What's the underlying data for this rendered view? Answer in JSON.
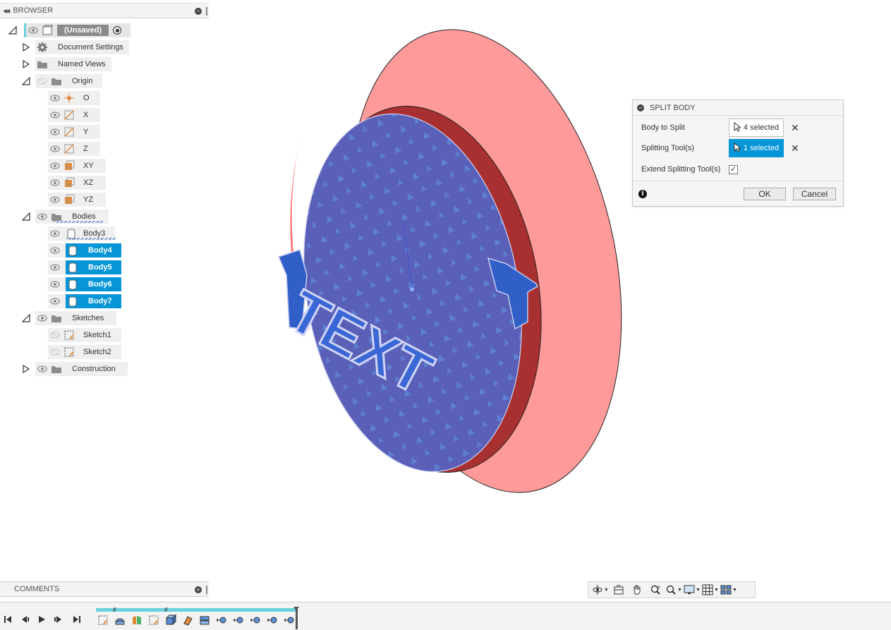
{
  "browser": {
    "title": "BROWSER",
    "root_label": "(Unsaved)",
    "items": {
      "document_settings": "Document Settings",
      "named_views": "Named Views",
      "origin": "Origin",
      "origin_o": "O",
      "origin_x": "X",
      "origin_y": "Y",
      "origin_z": "Z",
      "origin_xy": "XY",
      "origin_xz": "XZ",
      "origin_yz": "YZ",
      "bodies": "Bodies",
      "body3": "Body3",
      "body4": "Body4",
      "body5": "Body5",
      "body6": "Body6",
      "body7": "Body7",
      "sketches": "Sketches",
      "sketch1": "Sketch1",
      "sketch2": "Sketch2",
      "construction": "Construction"
    }
  },
  "dialog": {
    "title": "SPLIT BODY",
    "body_to_split_label": "Body to Split",
    "body_to_split_value": "4 selected",
    "splitting_tool_label": "Splitting Tool(s)",
    "splitting_tool_value": "1 selected",
    "extend_label": "Extend Splitting Tool(s)",
    "extend_checked": true,
    "ok_label": "OK",
    "cancel_label": "Cancel"
  },
  "comments": {
    "title": "COMMENTS"
  },
  "viewport": {
    "embossed_text": "TEXT"
  },
  "colors": {
    "accent": "#0696d7",
    "timeline": "#6ad1dd",
    "shell": "#ff9a9a",
    "inner_body": "#5a60b8",
    "rim": "#a83030"
  }
}
